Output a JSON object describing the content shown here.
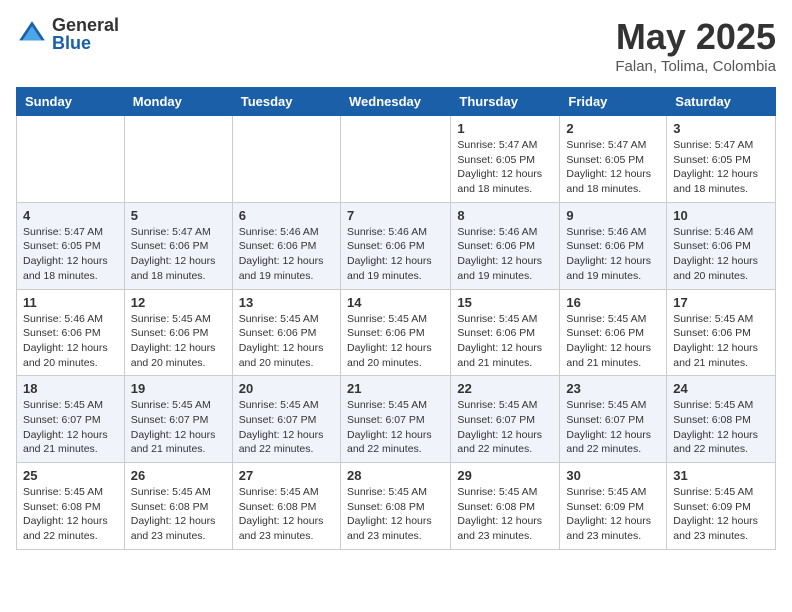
{
  "header": {
    "logo_general": "General",
    "logo_blue": "Blue",
    "month_title": "May 2025",
    "location": "Falan, Tolima, Colombia"
  },
  "weekdays": [
    "Sunday",
    "Monday",
    "Tuesday",
    "Wednesday",
    "Thursday",
    "Friday",
    "Saturday"
  ],
  "weeks": [
    [
      {
        "day": "",
        "info": ""
      },
      {
        "day": "",
        "info": ""
      },
      {
        "day": "",
        "info": ""
      },
      {
        "day": "",
        "info": ""
      },
      {
        "day": "1",
        "info": "Sunrise: 5:47 AM\nSunset: 6:05 PM\nDaylight: 12 hours\nand 18 minutes."
      },
      {
        "day": "2",
        "info": "Sunrise: 5:47 AM\nSunset: 6:05 PM\nDaylight: 12 hours\nand 18 minutes."
      },
      {
        "day": "3",
        "info": "Sunrise: 5:47 AM\nSunset: 6:05 PM\nDaylight: 12 hours\nand 18 minutes."
      }
    ],
    [
      {
        "day": "4",
        "info": "Sunrise: 5:47 AM\nSunset: 6:05 PM\nDaylight: 12 hours\nand 18 minutes."
      },
      {
        "day": "5",
        "info": "Sunrise: 5:47 AM\nSunset: 6:06 PM\nDaylight: 12 hours\nand 18 minutes."
      },
      {
        "day": "6",
        "info": "Sunrise: 5:46 AM\nSunset: 6:06 PM\nDaylight: 12 hours\nand 19 minutes."
      },
      {
        "day": "7",
        "info": "Sunrise: 5:46 AM\nSunset: 6:06 PM\nDaylight: 12 hours\nand 19 minutes."
      },
      {
        "day": "8",
        "info": "Sunrise: 5:46 AM\nSunset: 6:06 PM\nDaylight: 12 hours\nand 19 minutes."
      },
      {
        "day": "9",
        "info": "Sunrise: 5:46 AM\nSunset: 6:06 PM\nDaylight: 12 hours\nand 19 minutes."
      },
      {
        "day": "10",
        "info": "Sunrise: 5:46 AM\nSunset: 6:06 PM\nDaylight: 12 hours\nand 20 minutes."
      }
    ],
    [
      {
        "day": "11",
        "info": "Sunrise: 5:46 AM\nSunset: 6:06 PM\nDaylight: 12 hours\nand 20 minutes."
      },
      {
        "day": "12",
        "info": "Sunrise: 5:45 AM\nSunset: 6:06 PM\nDaylight: 12 hours\nand 20 minutes."
      },
      {
        "day": "13",
        "info": "Sunrise: 5:45 AM\nSunset: 6:06 PM\nDaylight: 12 hours\nand 20 minutes."
      },
      {
        "day": "14",
        "info": "Sunrise: 5:45 AM\nSunset: 6:06 PM\nDaylight: 12 hours\nand 20 minutes."
      },
      {
        "day": "15",
        "info": "Sunrise: 5:45 AM\nSunset: 6:06 PM\nDaylight: 12 hours\nand 21 minutes."
      },
      {
        "day": "16",
        "info": "Sunrise: 5:45 AM\nSunset: 6:06 PM\nDaylight: 12 hours\nand 21 minutes."
      },
      {
        "day": "17",
        "info": "Sunrise: 5:45 AM\nSunset: 6:06 PM\nDaylight: 12 hours\nand 21 minutes."
      }
    ],
    [
      {
        "day": "18",
        "info": "Sunrise: 5:45 AM\nSunset: 6:07 PM\nDaylight: 12 hours\nand 21 minutes."
      },
      {
        "day": "19",
        "info": "Sunrise: 5:45 AM\nSunset: 6:07 PM\nDaylight: 12 hours\nand 21 minutes."
      },
      {
        "day": "20",
        "info": "Sunrise: 5:45 AM\nSunset: 6:07 PM\nDaylight: 12 hours\nand 22 minutes."
      },
      {
        "day": "21",
        "info": "Sunrise: 5:45 AM\nSunset: 6:07 PM\nDaylight: 12 hours\nand 22 minutes."
      },
      {
        "day": "22",
        "info": "Sunrise: 5:45 AM\nSunset: 6:07 PM\nDaylight: 12 hours\nand 22 minutes."
      },
      {
        "day": "23",
        "info": "Sunrise: 5:45 AM\nSunset: 6:07 PM\nDaylight: 12 hours\nand 22 minutes."
      },
      {
        "day": "24",
        "info": "Sunrise: 5:45 AM\nSunset: 6:08 PM\nDaylight: 12 hours\nand 22 minutes."
      }
    ],
    [
      {
        "day": "25",
        "info": "Sunrise: 5:45 AM\nSunset: 6:08 PM\nDaylight: 12 hours\nand 22 minutes."
      },
      {
        "day": "26",
        "info": "Sunrise: 5:45 AM\nSunset: 6:08 PM\nDaylight: 12 hours\nand 23 minutes."
      },
      {
        "day": "27",
        "info": "Sunrise: 5:45 AM\nSunset: 6:08 PM\nDaylight: 12 hours\nand 23 minutes."
      },
      {
        "day": "28",
        "info": "Sunrise: 5:45 AM\nSunset: 6:08 PM\nDaylight: 12 hours\nand 23 minutes."
      },
      {
        "day": "29",
        "info": "Sunrise: 5:45 AM\nSunset: 6:08 PM\nDaylight: 12 hours\nand 23 minutes."
      },
      {
        "day": "30",
        "info": "Sunrise: 5:45 AM\nSunset: 6:09 PM\nDaylight: 12 hours\nand 23 minutes."
      },
      {
        "day": "31",
        "info": "Sunrise: 5:45 AM\nSunset: 6:09 PM\nDaylight: 12 hours\nand 23 minutes."
      }
    ]
  ]
}
